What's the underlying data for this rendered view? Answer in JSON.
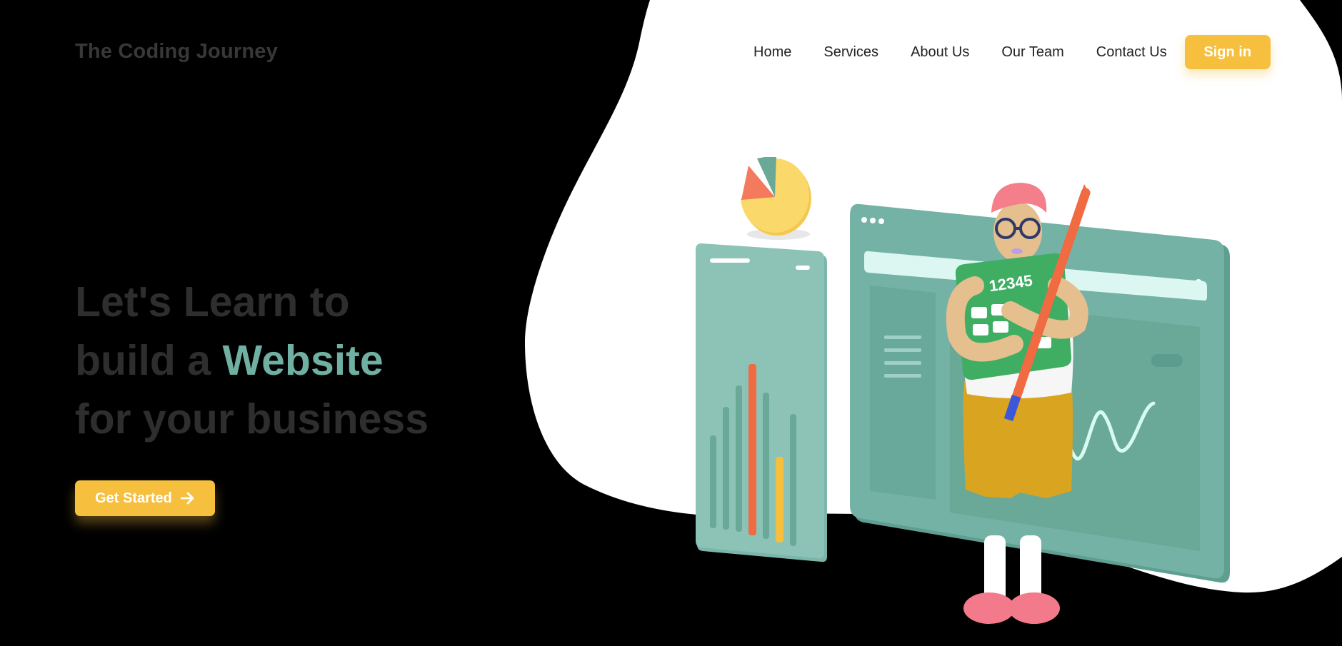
{
  "brand": {
    "name": "The Coding Journey"
  },
  "nav": {
    "items": [
      {
        "label": "Home"
      },
      {
        "label": "Services"
      },
      {
        "label": "About Us"
      },
      {
        "label": "Our Team"
      },
      {
        "label": "Contact Us"
      }
    ],
    "signin_label": "Sign in"
  },
  "hero": {
    "line1": "Let's Learn to",
    "line2_prefix": "build a ",
    "line2_accent": "Website",
    "line3": "for your business"
  },
  "cta": {
    "label": "Get Started",
    "icon": "arrow-right-icon"
  },
  "illustration": {
    "calculator_text": "12345"
  },
  "colors": {
    "background": "#000000",
    "blob": "#ffffff",
    "accent_yellow": "#f6bf3e",
    "accent_teal": "#6fb0a2",
    "hero_text": "#2e2e2e",
    "brand_text": "#383838"
  }
}
